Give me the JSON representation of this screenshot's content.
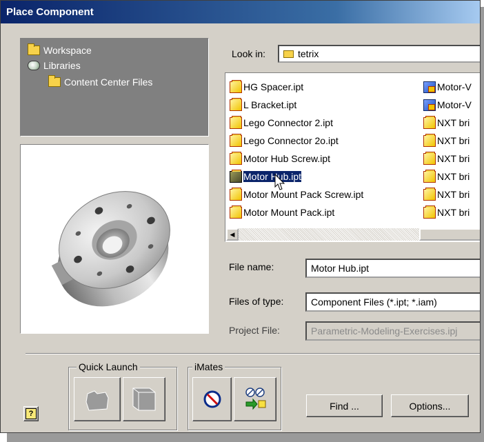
{
  "dialog": {
    "title": "Place Component"
  },
  "tree": {
    "items": [
      {
        "label": "Workspace",
        "icon": "folder-icon"
      },
      {
        "label": "Libraries",
        "icon": "libraries-icon"
      },
      {
        "label": "Content Center Files",
        "icon": "folder-icon"
      }
    ]
  },
  "lookin": {
    "label": "Look in:",
    "value": "tetrix"
  },
  "files": {
    "col1": [
      "HG Spacer.ipt",
      "L Bracket.ipt",
      "Lego Connector 2.ipt",
      "Lego Connector 2o.ipt",
      "Motor Hub Screw.ipt",
      "Motor Hub.ipt",
      "Motor Mount Pack Screw.ipt",
      "Motor Mount Pack.ipt"
    ],
    "col2": [
      "Motor-V",
      "Motor-V",
      "NXT bri",
      "NXT bri",
      "NXT bri",
      "NXT bri",
      "NXT bri",
      "NXT bri"
    ],
    "selected": "Motor Hub.ipt"
  },
  "form": {
    "filename_label": "File name:",
    "filename_value": "Motor Hub.ipt",
    "filetype_label": "Files of type:",
    "filetype_value": "Component Files (*.ipt; *.iam)",
    "project_label": "Project File:",
    "project_value": "Parametric-Modeling-Exercises.ipj"
  },
  "quick_launch": {
    "label": "Quick Launch"
  },
  "imates": {
    "label": "iMates"
  },
  "buttons": {
    "help": "?",
    "find": "Find ...",
    "options": "Options..."
  }
}
